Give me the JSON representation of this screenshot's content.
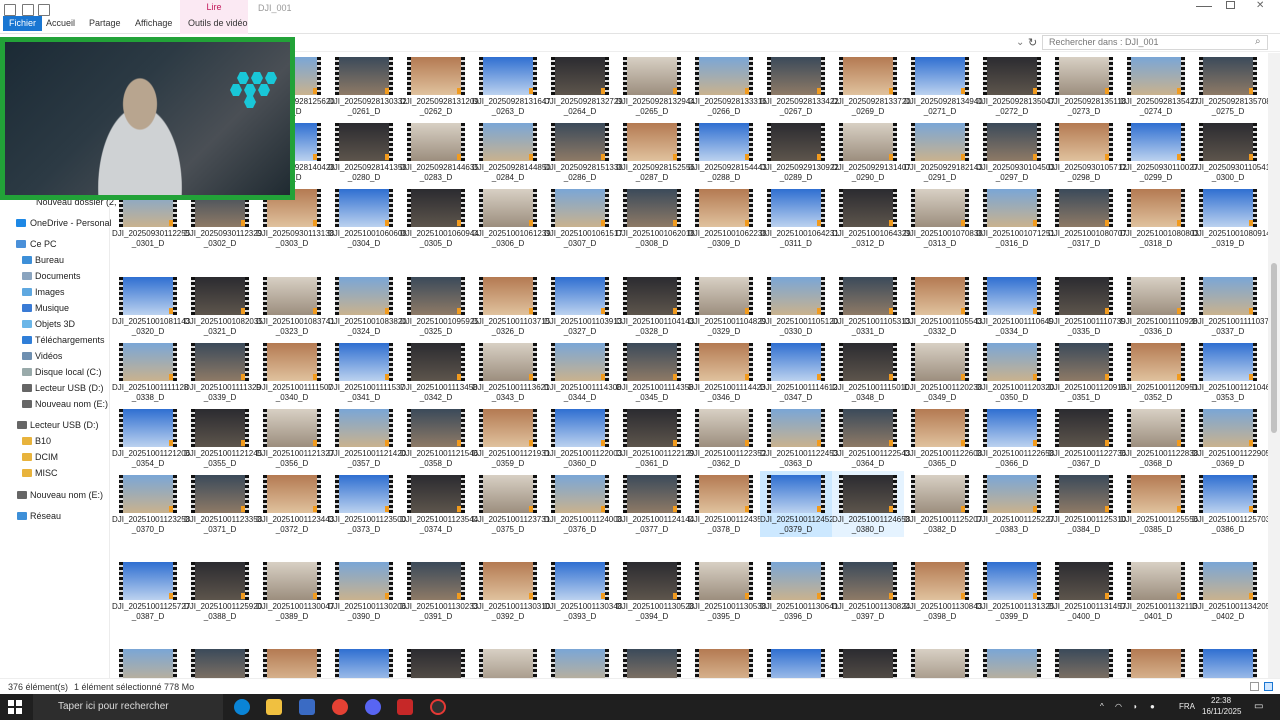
{
  "window": {
    "title": "DJI_001",
    "context_tab": "Lire",
    "tabs": [
      "Fichier",
      "Accueil",
      "Partage",
      "Affichage",
      "Outils de vidéo"
    ]
  },
  "search": {
    "placeholder": "Rechercher dans : DJI_001"
  },
  "nav": {
    "items": [
      {
        "label": "Nouveau dossier (2,",
        "y": 0
      },
      {
        "label": "OneDrive - Personal"
      },
      {
        "label": "Ce PC"
      },
      {
        "label": "Bureau"
      },
      {
        "label": "Documents"
      },
      {
        "label": "Images"
      },
      {
        "label": "Musique"
      },
      {
        "label": "Objets 3D"
      },
      {
        "label": "Téléchargements"
      },
      {
        "label": "Vidéos"
      },
      {
        "label": "Disque local (C:)"
      },
      {
        "label": "Lecteur USB (D:)"
      },
      {
        "label": "Nouveau nom (E:)"
      },
      {
        "label": "Lecteur USB (D:)"
      },
      {
        "label": "B10"
      },
      {
        "label": "DCIM"
      },
      {
        "label": "MISC"
      },
      {
        "label": "Nouveau nom (E:)"
      },
      {
        "label": "Réseau"
      }
    ]
  },
  "files": [
    [
      [
        "DJI_20250928125620",
        "60_D"
      ],
      [
        "DJI_20250928130332",
        "_0261_D"
      ],
      [
        "DJI_20250928131209",
        "_0262_D"
      ],
      [
        "DJI_20250928131647",
        "_0263_D"
      ],
      [
        "DJI_20250928132729",
        "_0264_D"
      ],
      [
        "DJI_20250928132944",
        "_0265_D"
      ],
      [
        "DJI_20250928133316",
        "_0266_D"
      ],
      [
        "DJI_20250928133422",
        "_0267_D"
      ],
      [
        "DJI_20250928133720",
        "_0269_D"
      ],
      [
        "DJI_20250928134940",
        "_0271_D"
      ],
      [
        "DJI_20250928135047",
        "_0272_D"
      ],
      [
        "DJI_20250928135118",
        "_0273_D"
      ],
      [
        "DJI_20250928135427",
        "_0274_D"
      ],
      [
        "DJI_20250928135708",
        "_0275_D"
      ]
    ],
    [
      [
        "DJI_20250928140428",
        "78_D"
      ],
      [
        "DJI_20250928141358",
        "_0280_D"
      ],
      [
        "DJI_20250928144635",
        "_0283_D"
      ],
      [
        "DJI_20250928144850",
        "_0284_D"
      ],
      [
        "DJI_20250928151338",
        "_0286_D"
      ],
      [
        "DJI_20250928152556",
        "_0287_D"
      ],
      [
        "DJI_20250928154443",
        "_0288_D"
      ],
      [
        "DJI_20250929130922",
        "_0289_D"
      ],
      [
        "DJI_20250929131407",
        "_0290_D"
      ],
      [
        "DJI_20250929182143",
        "_0291_D"
      ],
      [
        "DJI_20250930104503",
        "_0297_D"
      ],
      [
        "DJI_20250930105712",
        "_0298_D"
      ],
      [
        "DJI_20250930110027",
        "_0299_D"
      ],
      [
        "DJI_20250930110541",
        "_0300_D"
      ]
    ],
    [
      [
        "DJI_20250930112255",
        "_0301_D"
      ],
      [
        "DJI_20250930112329",
        "_0302_D"
      ],
      [
        "DJI_20250930113138",
        "_0303_D"
      ],
      [
        "DJI_20251001060608",
        "_0304_D"
      ],
      [
        "DJI_20251001060944",
        "_0305_D"
      ],
      [
        "DJI_20251001061239",
        "_0306_D"
      ],
      [
        "DJI_20251001061517",
        "_0307_D"
      ],
      [
        "DJI_20251001062018",
        "_0308_D"
      ],
      [
        "DJI_20251001062238",
        "_0309_D"
      ],
      [
        "DJI_20251001064231",
        "_0311_D"
      ],
      [
        "DJI_20251001064329",
        "_0312_D"
      ],
      [
        "DJI_20251001070838",
        "_0313_D"
      ],
      [
        "DJI_20251001071251",
        "_0316_D"
      ],
      [
        "DJI_20251001080707",
        "_0317_D"
      ],
      [
        "DJI_20251001080803",
        "_0318_D"
      ],
      [
        "DJI_20251001080914",
        "_0319_D"
      ]
    ],
    [
      [
        "DJI_20251001081143",
        "_0320_D"
      ],
      [
        "DJI_20251001082035",
        "_0321_D"
      ],
      [
        "DJI_20251001083741",
        "_0323_D"
      ],
      [
        "DJI_20251001083820",
        "_0324_D"
      ],
      [
        "DJI_20251001095925",
        "_0325_D"
      ],
      [
        "DJI_20251001103715",
        "_0326_D"
      ],
      [
        "DJI_20251001103913",
        "_0327_D"
      ],
      [
        "DJI_20251001104143",
        "_0328_D"
      ],
      [
        "DJI_20251001104829",
        "_0329_D"
      ],
      [
        "DJI_20251001105120",
        "_0330_D"
      ],
      [
        "DJI_20251001105313",
        "_0331_D"
      ],
      [
        "DJI_20251001105543",
        "_0332_D"
      ],
      [
        "DJI_20251001110649",
        "_0334_D"
      ],
      [
        "DJI_20251001110739",
        "_0335_D"
      ],
      [
        "DJI_20251001110928",
        "_0336_D"
      ],
      [
        "DJI_20251001111037",
        "_0337_D"
      ]
    ],
    [
      [
        "DJI_20251001111128",
        "_0338_D"
      ],
      [
        "DJI_20251001111329",
        "_0339_D"
      ],
      [
        "DJI_20251001111507",
        "_0340_D"
      ],
      [
        "DJI_20251001111537",
        "_0341_D"
      ],
      [
        "DJI_20251001113458",
        "_0342_D"
      ],
      [
        "DJI_20251001113621",
        "_0343_D"
      ],
      [
        "DJI_20251001114308",
        "_0344_D"
      ],
      [
        "DJI_20251001114358",
        "_0345_D"
      ],
      [
        "DJI_20251001114423",
        "_0346_D"
      ],
      [
        "DJI_20251001114612",
        "_0347_D"
      ],
      [
        "DJI_20251001115010",
        "_0348_D"
      ],
      [
        "DJI_20251001120238",
        "_0349_D"
      ],
      [
        "DJI_20251001120320",
        "_0350_D"
      ],
      [
        "DJI_20251001120916",
        "_0351_D"
      ],
      [
        "DJI_20251001120951",
        "_0352_D"
      ],
      [
        "DJI_20251001121046",
        "_0353_D"
      ]
    ],
    [
      [
        "DJI_20251001121206",
        "_0354_D"
      ],
      [
        "DJI_20251001121245",
        "_0355_D"
      ],
      [
        "DJI_20251001121327",
        "_0356_D"
      ],
      [
        "DJI_20251001121420",
        "_0357_D"
      ],
      [
        "DJI_20251001121546",
        "_0358_D"
      ],
      [
        "DJI_20251001121931",
        "_0359_D"
      ],
      [
        "DJI_20251001122003",
        "_0360_D"
      ],
      [
        "DJI_20251001122129",
        "_0361_D"
      ],
      [
        "DJI_20251001122352",
        "_0362_D"
      ],
      [
        "DJI_20251001122453",
        "_0363_D"
      ],
      [
        "DJI_20251001122543",
        "_0364_D"
      ],
      [
        "DJI_20251001122608",
        "_0365_D"
      ],
      [
        "DJI_20251001122658",
        "_0366_D"
      ],
      [
        "DJI_20251001122736",
        "_0367_D"
      ],
      [
        "DJI_20251001122838",
        "_0368_D"
      ],
      [
        "DJI_20251001122905",
        "_0369_D"
      ]
    ],
    [
      [
        "DJI_20251001123258",
        "_0370_D"
      ],
      [
        "DJI_20251001123358",
        "_0371_D"
      ],
      [
        "DJI_20251001123443",
        "_0372_D"
      ],
      [
        "DJI_20251001123500",
        "_0373_D"
      ],
      [
        "DJI_20251001123544",
        "_0374_D"
      ],
      [
        "DJI_20251001123731",
        "_0375_D"
      ],
      [
        "DJI_20251001124008",
        "_0376_D"
      ],
      [
        "DJI_20251001124144",
        "_0377_D"
      ],
      [
        "DJI_20251001124357",
        "_0378_D"
      ],
      [
        "DJI_20251001124520",
        "_0379_D"
      ],
      [
        "DJI_20251001124658",
        "_0380_D"
      ],
      [
        "DJI_20251001125207",
        "_0382_D"
      ],
      [
        "DJI_20251001125227",
        "_0383_D"
      ],
      [
        "DJI_20251001125310",
        "_0384_D"
      ],
      [
        "DJI_20251001125556",
        "_0385_D"
      ],
      [
        "DJI_20251001125703",
        "_0386_D"
      ]
    ],
    [
      [
        "DJI_20251001125727",
        "_0387_D"
      ],
      [
        "DJI_20251001125920",
        "_0388_D"
      ],
      [
        "DJI_20251001130047",
        "_0389_D"
      ],
      [
        "DJI_20251001130206",
        "_0390_D"
      ],
      [
        "DJI_20251001130233",
        "_0391_D"
      ],
      [
        "DJI_20251001130310",
        "_0392_D"
      ],
      [
        "DJI_20251001130348",
        "_0393_D"
      ],
      [
        "DJI_20251001130528",
        "_0394_D"
      ],
      [
        "DJI_20251001130538",
        "_0395_D"
      ],
      [
        "DJI_20251001130641",
        "_0396_D"
      ],
      [
        "DJI_20251001130824",
        "_0397_D"
      ],
      [
        "DJI_20251001130843",
        "_0398_D"
      ],
      [
        "DJI_20251001131325",
        "_0399_D"
      ],
      [
        "DJI_20251001131457",
        "_0400_D"
      ],
      [
        "DJI_20251001132113",
        "_0401_D"
      ],
      [
        "DJI_20251001134205",
        "_0402_D"
      ]
    ]
  ],
  "status": {
    "count": "376 élément(s)",
    "selection": "1 élément sélectionné  778 Mo"
  },
  "taskbar": {
    "search_placeholder": "Taper ici pour rechercher",
    "lang": "FRA",
    "time": "22:38",
    "date": "16/11/2025"
  },
  "colors": {
    "accent": "#1976d2",
    "webcam_border": "#22a238",
    "context_tab": "#c2185b"
  }
}
